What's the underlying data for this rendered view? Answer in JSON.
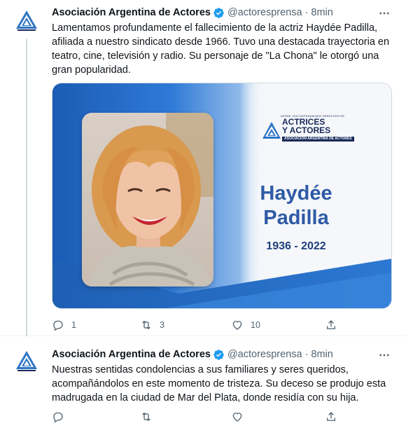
{
  "tweets": [
    {
      "author": "Asociación Argentina de Actores",
      "handle": "@actoresprensa",
      "separator": "·",
      "time": "8min",
      "text": "Lamentamos profundamente el fallecimiento de la actriz Haydée Padilla, afiliada a nuestro sindicato desde 1966. Tuvo una destacada trayectoria en teatro, cine, televisión y radio. Su personaje de \"La Chona\" le otorgó una gran popularidad.",
      "media": {
        "logo_small": "DESDE 1919 DEFENDIENDO DERECHOS DE",
        "logo_title_line1": "ACTRICES",
        "logo_title_line2": "Y ACTORES",
        "logo_subtitle": "ASOCIACIÓN ARGENTINA DE ACTORES",
        "name_line1": "Haydée",
        "name_line2": "Padilla",
        "years": "1936 - 2022"
      },
      "stats": {
        "replies": "1",
        "retweets": "3",
        "likes": "10"
      }
    },
    {
      "author": "Asociación Argentina de Actores",
      "handle": "@actoresprensa",
      "separator": "·",
      "time": "8min",
      "text": "Nuestras sentidas condolencias a sus familiares y seres queridos, acompañándolos en este momento de tristeza. Su deceso se produjo esta madrugada en la ciudad de Mar del Plata, donde residía con su hija.",
      "stats": {
        "replies": "",
        "retweets": "",
        "likes": ""
      }
    }
  ],
  "icons": {
    "avatar": "triangle-logo-icon",
    "verified": "verified-badge-icon",
    "more": "more-options-icon",
    "reply": "reply-icon",
    "retweet": "retweet-icon",
    "like": "like-icon",
    "share": "share-icon"
  },
  "colors": {
    "verified": "#1d9bf0",
    "brand_blue": "#1e5fb3",
    "muted_text": "#536471",
    "name_blue": "#2d5aa6"
  }
}
